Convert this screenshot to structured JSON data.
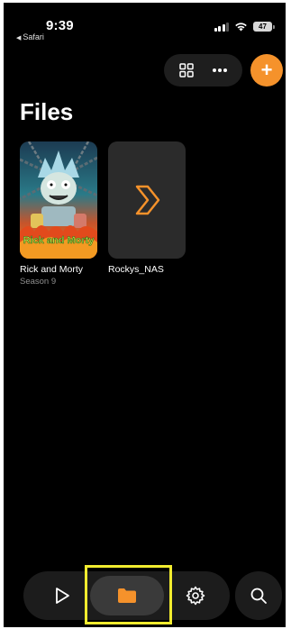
{
  "status_bar": {
    "time": "9:39",
    "back_app": "Safari",
    "battery": "47"
  },
  "toolbar": {
    "grid_icon": "grid-icon",
    "more_icon": "more-icon",
    "add_label": "+",
    "accent_color": "#f5922b"
  },
  "page": {
    "title": "Files"
  },
  "tiles": [
    {
      "name": "Rick and Morty",
      "subtitle": "Season 9",
      "art_text": "Rick and Morty"
    },
    {
      "name": "Rockys_NAS",
      "subtitle": "",
      "icon": "chevron-right-icon"
    }
  ],
  "bottom_nav": {
    "items": [
      "play-icon",
      "folder-icon",
      "gear-icon"
    ],
    "active": "folder-icon",
    "search_icon": "search-icon"
  },
  "highlight_color": "#f2ec2f"
}
